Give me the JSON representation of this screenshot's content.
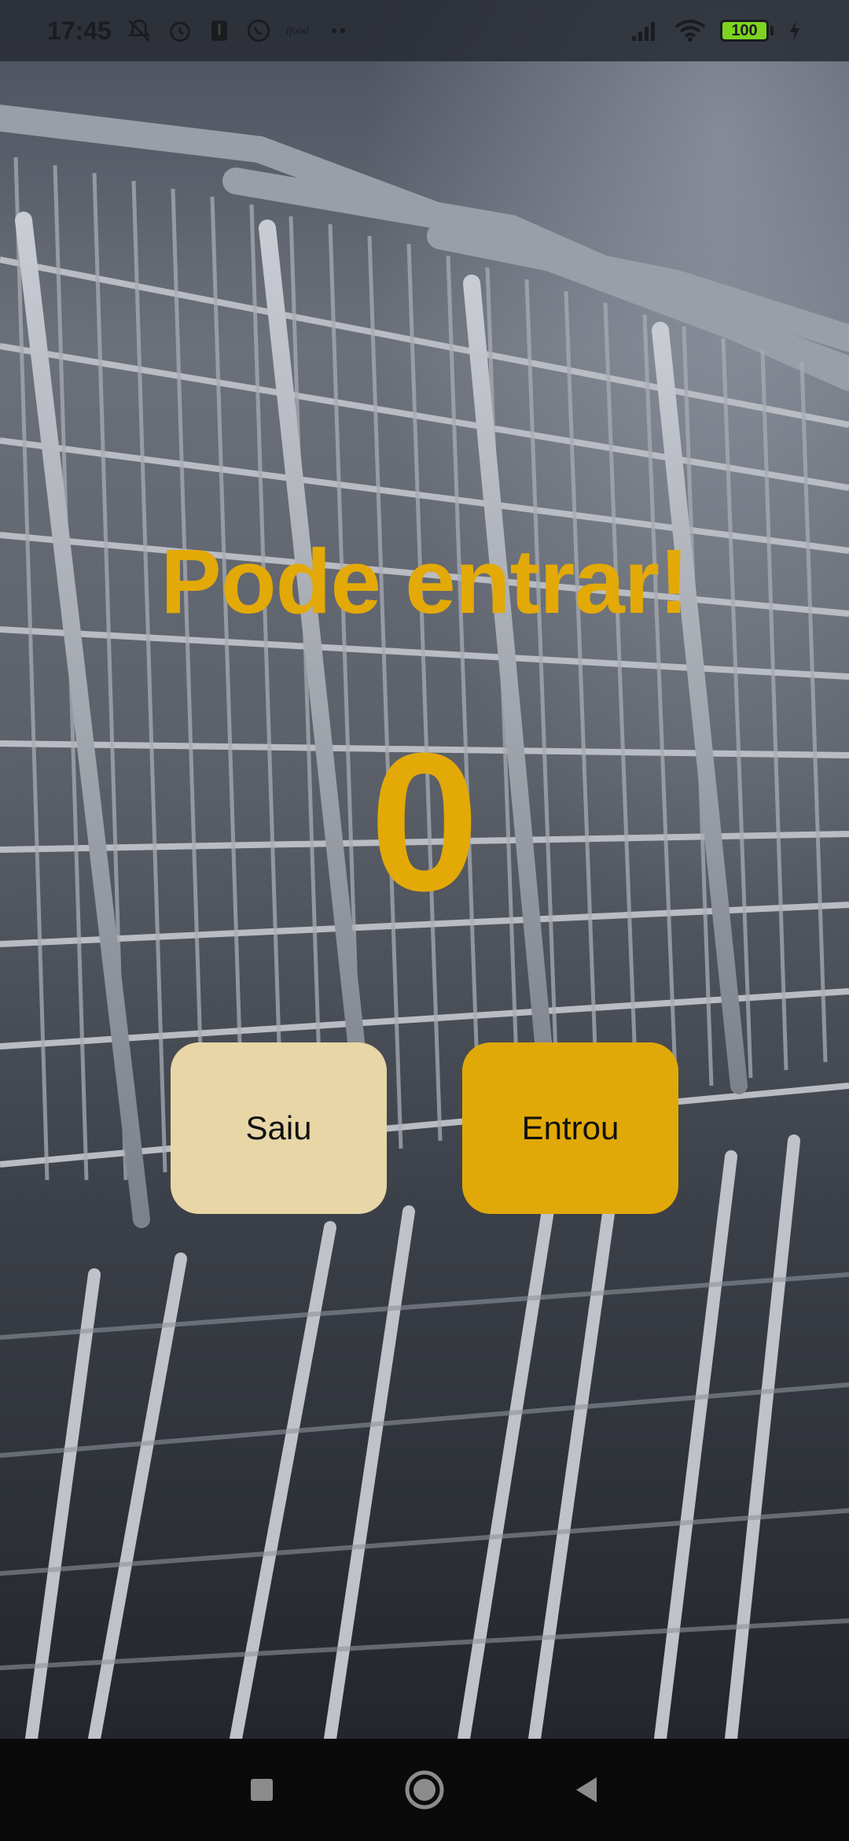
{
  "status_bar": {
    "time": "17:45",
    "battery_level": "100",
    "icons": [
      "notifications-off-icon",
      "alarm-icon",
      "usb-icon",
      "whatsapp-icon",
      "app-notification-icon",
      "more-dots-icon",
      "signal-icon",
      "wifi-icon",
      "battery-icon",
      "charging-icon"
    ]
  },
  "main": {
    "headline": "Pode entrar!",
    "counter": "0",
    "buttons": {
      "exit_label": "Saiu",
      "enter_label": "Entrou"
    }
  },
  "nav_bar": {
    "icons": [
      "recents-icon",
      "home-icon",
      "back-icon"
    ]
  },
  "colors": {
    "accent": "#e3a907",
    "exit_button": "#e8d6a6",
    "enter_button": "#e1a907"
  },
  "background": {
    "image": "shopping-carts-photo"
  }
}
